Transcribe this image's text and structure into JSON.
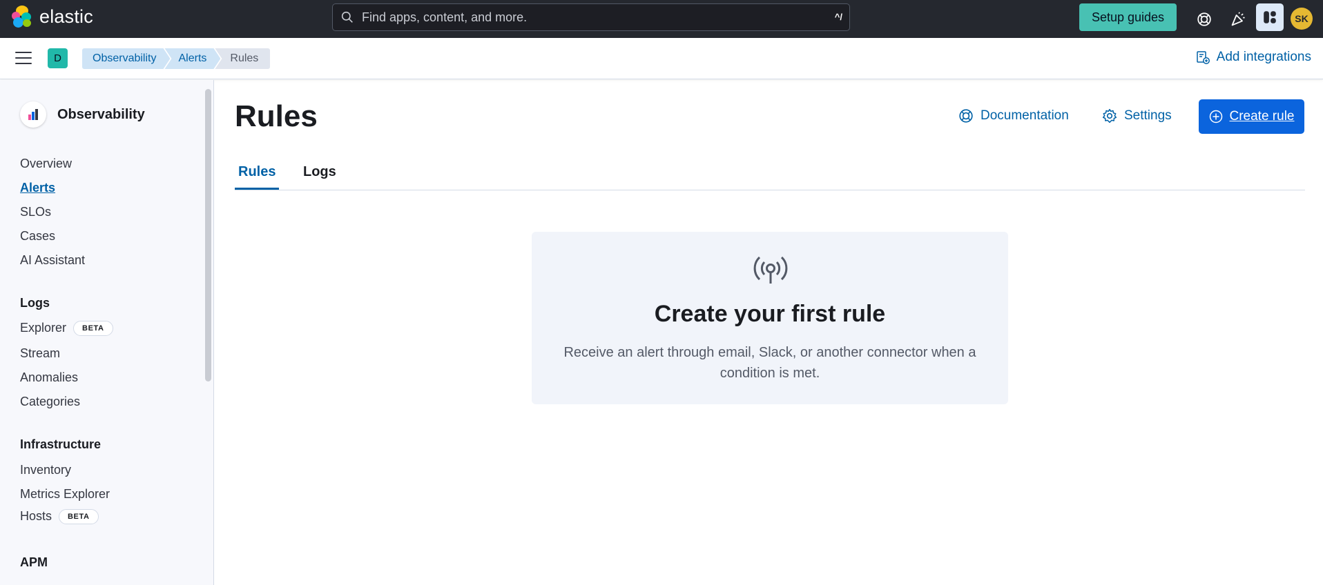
{
  "topbar": {
    "brand": "elastic",
    "search_placeholder": "Find apps, content, and more.",
    "search_shortcut": "^/",
    "setup_guides": "Setup guides",
    "avatar_initials": "SK",
    "icons": [
      "help-icon",
      "whats-new-icon",
      "app-switcher-icon"
    ]
  },
  "subbar": {
    "space_initial": "D",
    "breadcrumbs": [
      "Observability",
      "Alerts",
      "Rules"
    ],
    "add_integrations": "Add integrations"
  },
  "sidebar": {
    "title": "Observability",
    "top_items": [
      "Overview",
      "Alerts",
      "SLOs",
      "Cases",
      "AI Assistant"
    ],
    "active_item": "Alerts",
    "groups": [
      {
        "label": "Logs",
        "items": [
          {
            "label": "Explorer",
            "badge": "BETA"
          },
          {
            "label": "Stream"
          },
          {
            "label": "Anomalies"
          },
          {
            "label": "Categories"
          }
        ]
      },
      {
        "label": "Infrastructure",
        "items": [
          {
            "label": "Inventory"
          },
          {
            "label": "Metrics Explorer"
          },
          {
            "label": "Hosts",
            "badge": "BETA"
          }
        ]
      },
      {
        "label": "APM",
        "items": []
      }
    ]
  },
  "main": {
    "title": "Rules",
    "documentation": "Documentation",
    "settings": "Settings",
    "create_rule": "Create rule",
    "tabs": [
      "Rules",
      "Logs"
    ],
    "active_tab": "Rules",
    "empty_state": {
      "icon": "broadcast-antenna-icon",
      "title": "Create your first rule",
      "body": "Receive an alert through email, Slack, or another connector when a condition is met."
    }
  },
  "colors": {
    "topbar_bg": "#25282f",
    "accent_link": "#0061a6",
    "primary_button": "#0b64dd",
    "setup_button": "#48c1b3",
    "sidebar_bg": "#f7f8fc"
  }
}
